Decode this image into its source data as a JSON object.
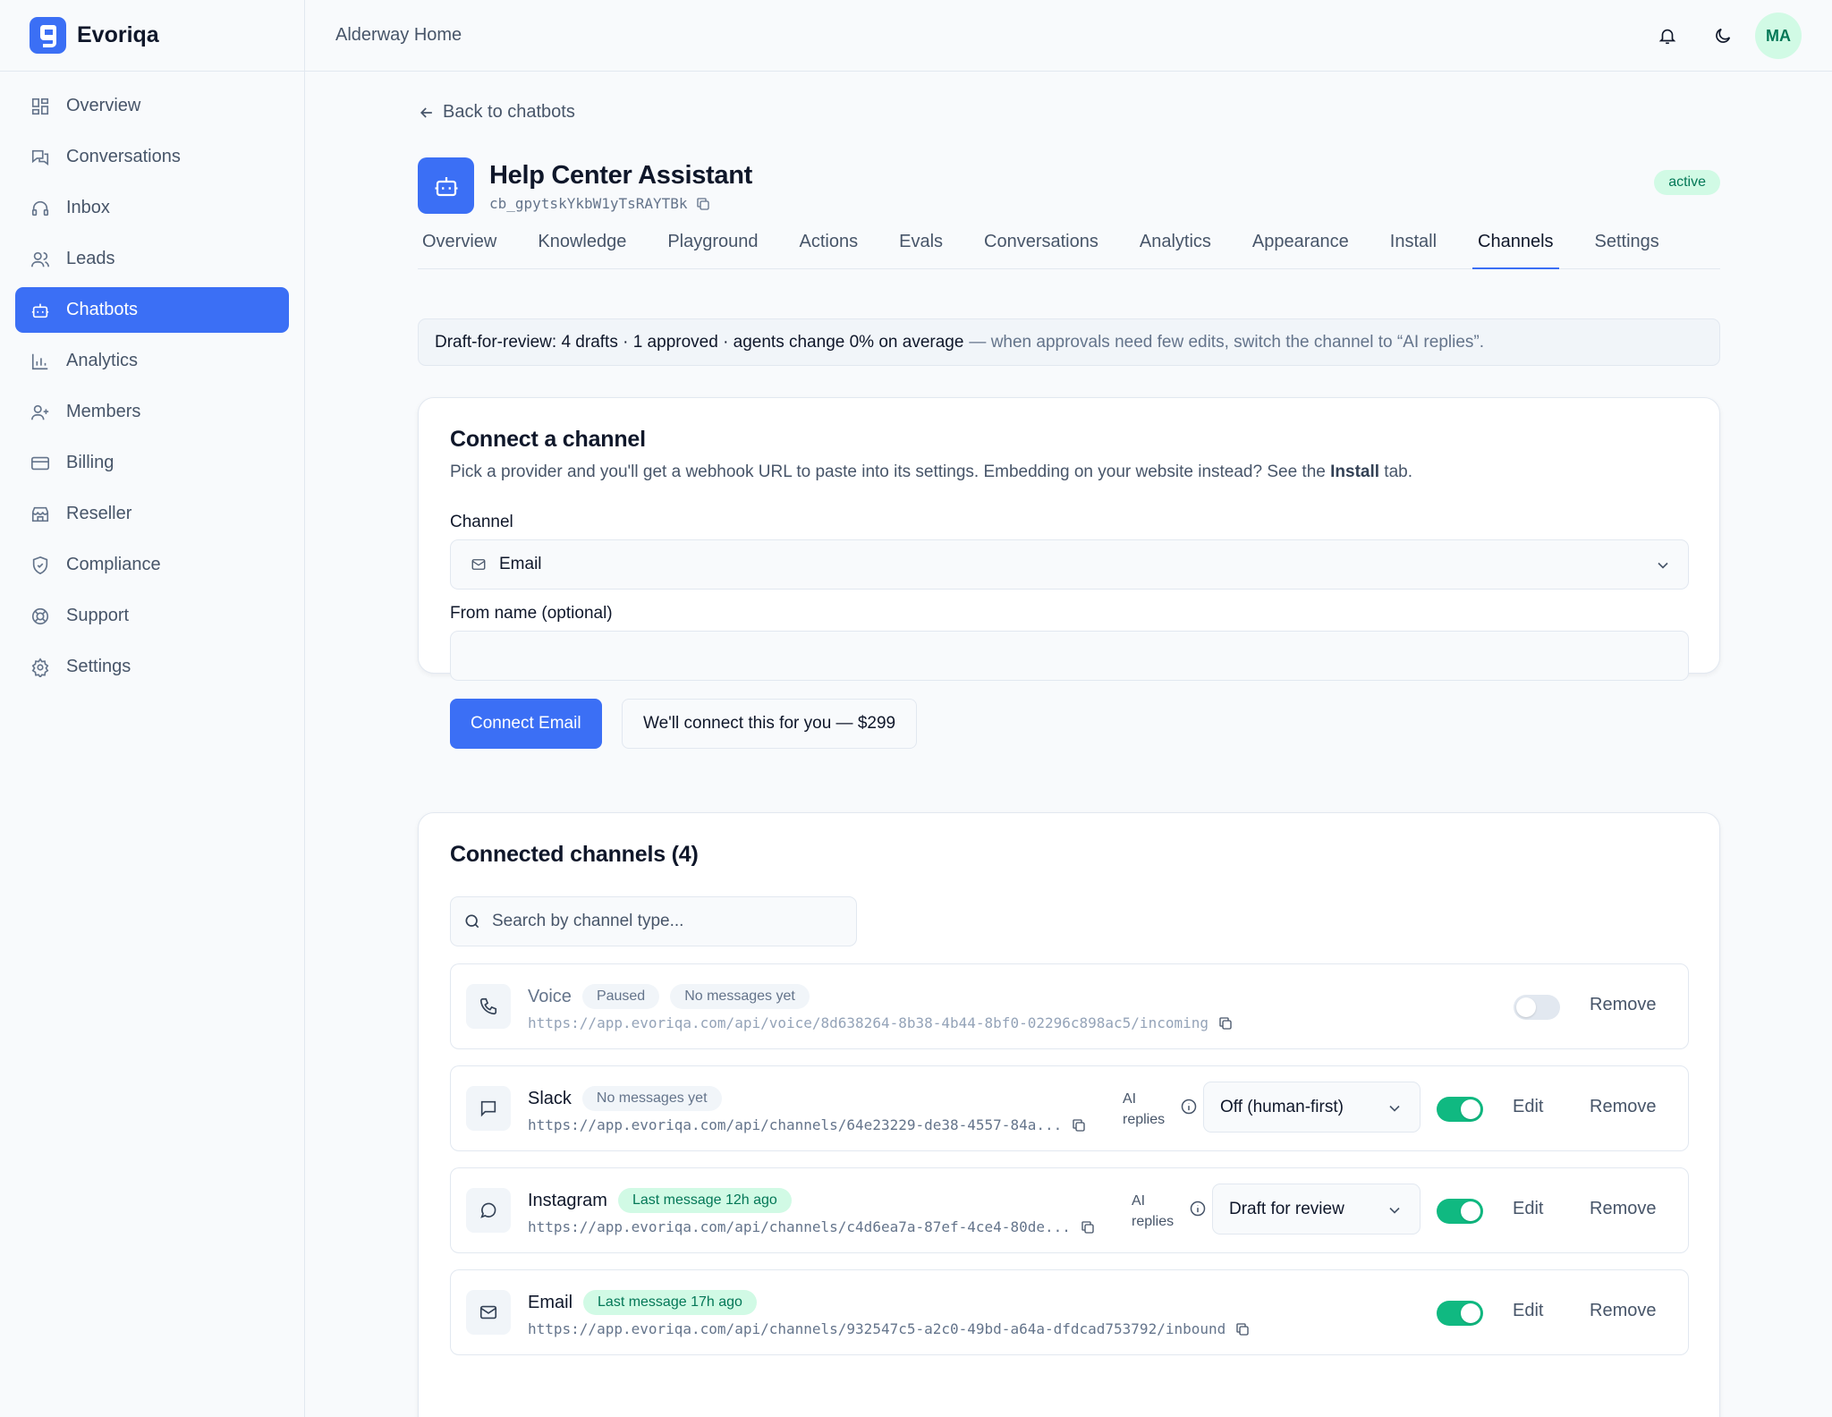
{
  "brand": {
    "name": "Evoriqa"
  },
  "workspace": {
    "name": "Alderway Home"
  },
  "user": {
    "initials": "MA"
  },
  "sidebar": {
    "items": [
      {
        "label": "Overview",
        "icon": "dashboard-icon"
      },
      {
        "label": "Conversations",
        "icon": "chat-bubbles-icon"
      },
      {
        "label": "Inbox",
        "icon": "headset-icon"
      },
      {
        "label": "Leads",
        "icon": "users-icon"
      },
      {
        "label": "Chatbots",
        "icon": "bot-icon",
        "active": true
      },
      {
        "label": "Analytics",
        "icon": "bar-chart-icon"
      },
      {
        "label": "Members",
        "icon": "user-plus-icon"
      },
      {
        "label": "Billing",
        "icon": "credit-card-icon"
      },
      {
        "label": "Reseller",
        "icon": "store-icon"
      },
      {
        "label": "Compliance",
        "icon": "shield-icon"
      },
      {
        "label": "Support",
        "icon": "life-buoy-icon"
      },
      {
        "label": "Settings",
        "icon": "gear-icon"
      }
    ]
  },
  "page": {
    "back_label": "Back to chatbots",
    "bot_title": "Help Center Assistant",
    "bot_id": "cb_gpytskYkbW1yTsRAYTBk",
    "status": "active",
    "tabs": [
      "Overview",
      "Knowledge",
      "Playground",
      "Actions",
      "Evals",
      "Conversations",
      "Analytics",
      "Appearance",
      "Install",
      "Channels",
      "Settings"
    ],
    "active_tab": "Channels"
  },
  "banner": {
    "strong": "Draft-for-review: 4 drafts · 1 approved · agents change 0% on average",
    "muted": "— when approvals need few edits, switch the channel to “AI replies”."
  },
  "connect": {
    "title": "Connect a channel",
    "desc_before": "Pick a provider and you'll get a webhook URL to paste into its settings. Embedding on your website instead? See the ",
    "desc_bold": "Install",
    "desc_after": " tab.",
    "channel_label": "Channel",
    "channel_value": "Email",
    "from_label": "From name (optional)",
    "from_value": "",
    "connect_button": "Connect Email",
    "service_button": "We'll connect this for you — $299"
  },
  "connected": {
    "title": "Connected channels (4)",
    "search_placeholder": "Search by channel type...",
    "ai_label_line1": "AI",
    "ai_label_line2": "replies",
    "edit_label": "Edit",
    "remove_label": "Remove",
    "channels": [
      {
        "name": "Voice",
        "badges": [
          "Paused",
          "No messages yet"
        ],
        "url": "https://app.evoriqa.com/api/voice/8d638264-8b38-4b44-8bf0-02296c898ac5/incoming",
        "enabled": false,
        "icon": "phone-icon"
      },
      {
        "name": "Slack",
        "badges": [
          "No messages yet"
        ],
        "url": "https://app.evoriqa.com/api/channels/64e23229-de38-4557-84a...",
        "ai_mode": "Off (human-first)",
        "enabled": true,
        "icon": "message-square-icon"
      },
      {
        "name": "Instagram",
        "badges": [
          "Last message 12h ago"
        ],
        "url": "https://app.evoriqa.com/api/channels/c4d6ea7a-87ef-4ce4-80de...",
        "ai_mode": "Draft for review",
        "enabled": true,
        "icon": "message-circle-icon"
      },
      {
        "name": "Email",
        "badges": [
          "Last message 17h ago"
        ],
        "url": "https://app.evoriqa.com/api/channels/932547c5-a2c0-49bd-a64a-dfdcad753792/inbound",
        "enabled": true,
        "icon": "mail-icon"
      }
    ]
  },
  "colors": {
    "accent": "#3b6ff5",
    "success": "#10b981",
    "badge_green_bg": "#d1fae5"
  }
}
